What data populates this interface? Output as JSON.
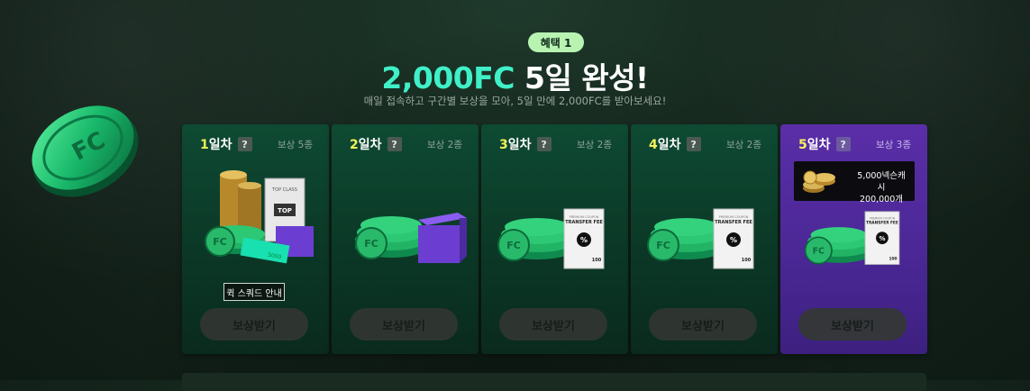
{
  "header": {
    "badge": "혜택 1",
    "title_highlight": "2,000FC",
    "title_rest": " 5일 완성!",
    "subtitle": "매일 접속하고 구간별 보상을 모아, 5일 만에 2,000FC를 받아보세요!"
  },
  "days": [
    {
      "num": "1",
      "suffix": "일차",
      "help": "?",
      "reward_count": "보상 5종",
      "guide_label": "퀵 스쿼드 안내",
      "claim_label": "보상받기"
    },
    {
      "num": "2",
      "suffix": "일차",
      "help": "?",
      "reward_count": "보상 2종",
      "claim_label": "보상받기"
    },
    {
      "num": "3",
      "suffix": "일차",
      "help": "?",
      "reward_count": "보상 2종",
      "claim_label": "보상받기"
    },
    {
      "num": "4",
      "suffix": "일차",
      "help": "?",
      "reward_count": "보상 2종",
      "claim_label": "보상받기"
    },
    {
      "num": "5",
      "suffix": "일차",
      "help": "?",
      "reward_count": "보상 3종",
      "claim_label": "보상받기",
      "info_line1": "5,000넥슨캐시",
      "info_line2": "200,000개"
    }
  ],
  "art_text": {
    "coin_fc": "FC",
    "top_class": "TOP CLASS",
    "top": "TOP",
    "ticket": "5000",
    "transfer_fee_small": "PREMIUM COUPON",
    "transfer_fee": "TRANSFER FEE",
    "percent": "%",
    "hundred": "100"
  },
  "colors": {
    "accent_cyan": "#3ff0c8",
    "day_number": "#f3f35a",
    "card_green": "#0e4a33",
    "card_purple": "#5a2ea8",
    "badge_bg": "#b9f3b2"
  },
  "icons": [
    "fc-coin-icon",
    "coin-stack-icon",
    "pack-box-icon",
    "coupon-card-icon",
    "gold-coins-icon"
  ]
}
